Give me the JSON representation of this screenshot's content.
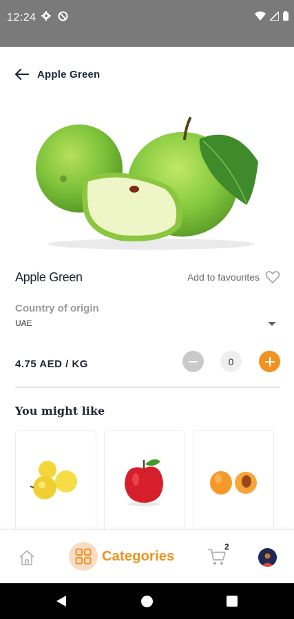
{
  "status_bar": {
    "time": "12:24"
  },
  "header": {
    "title": "Apple Green",
    "back_icon": "arrow-left-icon"
  },
  "product": {
    "name": "Apple Green",
    "favourite_label": "Add to favourites",
    "origin_label": "Country of origin",
    "origin_value": "UAE",
    "price": "4.75 AED / KG",
    "quantity": "0"
  },
  "suggestions": {
    "title": "You might like",
    "items": [
      {
        "icon": "yellow-apples-image"
      },
      {
        "icon": "red-apple-image"
      },
      {
        "icon": "apricots-image"
      }
    ]
  },
  "bottom_nav": {
    "categories_label": "Categories",
    "cart_count": "2"
  },
  "colors": {
    "accent": "#f0921e",
    "accent_soft": "#f8ddc6",
    "status_bar": "#7a7a7a",
    "text_dark": "#1f2430"
  }
}
